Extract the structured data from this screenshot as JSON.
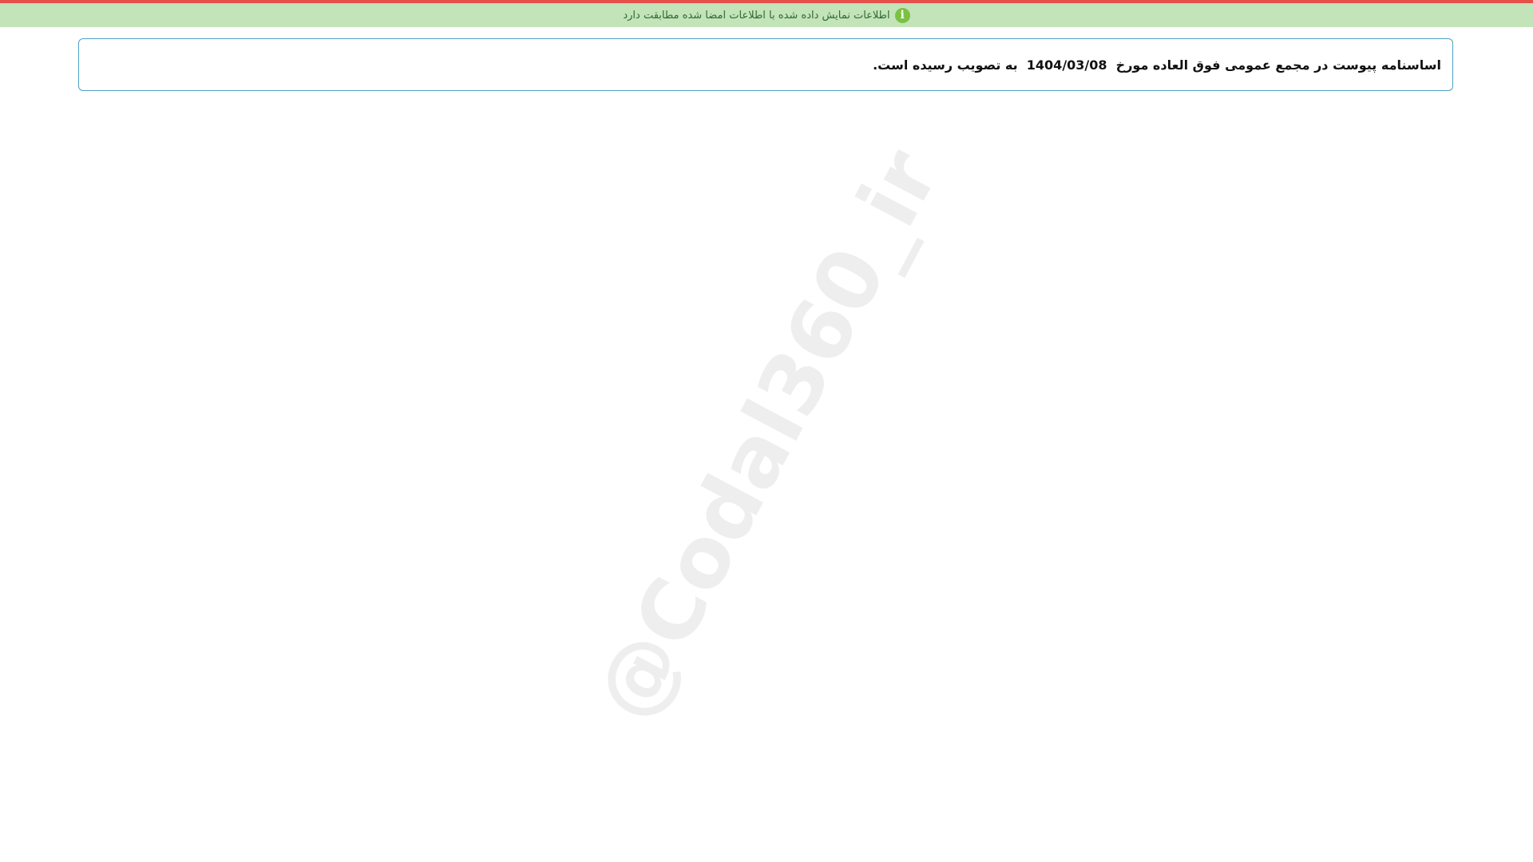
{
  "banner": {
    "icon": "info-icon",
    "text": "اطلاعات نمایش داده شده با اطلاعات امضا شده مطابقت دارد",
    "color": "#c3e3b9",
    "top_line_color": "#e5504a"
  },
  "notice": {
    "text": "اساسنامه پیوست در مجمع عمومی فوق العاده مورخ  1404/03/08  به تصویب رسیده است."
  },
  "watermark": {
    "text": "@Codal360_ir"
  }
}
